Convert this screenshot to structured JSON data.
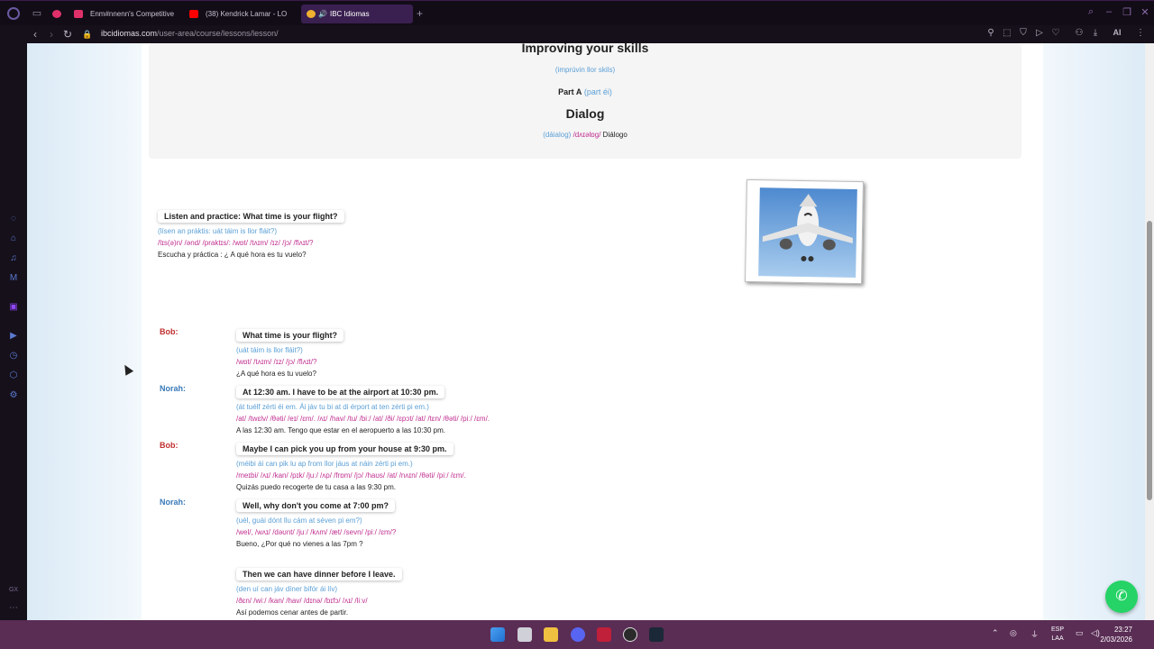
{
  "browser": {
    "tabs": [
      {
        "label": "Enm#nnenn's Competitive",
        "color": "#e0306a"
      },
      {
        "label": "(38) Kendrick Lamar - LO",
        "color": "#ff0000"
      },
      {
        "label": "IBC Idiomas",
        "color": "#f0b030"
      }
    ],
    "active_tab_icon": "speaker-icon",
    "url_host": "ibcidiomas.com",
    "url_path": "/user-area/course/lessons/lesson/",
    "right_icons": [
      "bookmark-icon",
      "snapshot-icon",
      "shield-icon",
      "play-icon",
      "heart-icon",
      "profile-icon",
      "download-icon"
    ],
    "ai_label": "AI"
  },
  "header": {
    "title": "Improving your skills",
    "title_pron": "(imprúvin llor skils)",
    "part_label": "Part A",
    "part_pron": "(part éi)",
    "dialog_title": "Dialog",
    "dialog_pron": "(dáialog)",
    "dialog_ipa": "/dʌɪəlɒg/",
    "dialog_es": "Diálogo"
  },
  "intro": {
    "title": "Listen and practice: What time is your flight?",
    "pron": "(lísen an práktis: uát táim is llor fláit?)",
    "ipa": "/lɪs(ə)n/ /ənd/ /praktɪs/: /wɒt/ /tʌɪm/ /ɪz/ /jɔ/ /flʌɪt/?",
    "es": "Escucha y práctica : ¿ A qué hora es tu vuelo?"
  },
  "dialog": [
    {
      "speaker": "Bob:",
      "speaker_color": "#c03030",
      "en": "What time is your flight?",
      "pron": "(uát táim is llor fláit?)",
      "ipa": "/wɒt/ /tʌɪm/ /ɪz/ /jɔ/ /flʌɪt/?",
      "es": "¿A qué hora es tu vuelo?"
    },
    {
      "speaker": "Norah:",
      "speaker_color": "#3a7ab8",
      "en": "At 12:30 am. I have to be at the airport at 10:30 pm.",
      "pron": "(át tuélf zérti éi em. Ái jáv tu bi at di érport at ten zérti pi em.)",
      "ipa": "/at/ /twɛlv/ /θəti/ /eɪ/ /ɛm/. /ʌɪ/ /hav/ /tu/ /biː/ /at/ /ði/ /ɛpɔt/ /at/ /tɛn/ /θəti/ /piː/ /ɛm/.",
      "es": "A las 12:30 am. Tengo que estar en el aeropuerto a las 10:30 pm."
    },
    {
      "speaker": "Bob:",
      "speaker_color": "#c03030",
      "en": "Maybe I can pick you up from your house at 9:30 pm.",
      "pron": "(méibi ái can pik lu ap from llor jáus at náin zérti pi em.)",
      "ipa": "/meɪbi/ /ʌɪ/ /kan/ /pɪk/ /juː/ /ʌp/ /frɒm/ /jɔ/ /haʊs/ /at/ /nʌɪn/ /θəti/ /piː/ /ɛm/.",
      "es": "Quizás puedo recogerte de tu casa a las 9:30 pm."
    },
    {
      "speaker": "Norah:",
      "speaker_color": "#3a7ab8",
      "en": "Well, why don't you come at 7:00 pm?",
      "pron": "(uél, guái dónt llu cám at séven pi em?)",
      "ipa": "/wel/, /wʌɪ/ /dəʊnt/ /juː/ /kʌm/ /æt/ /sevn/ /piː/ /ɛm/?",
      "es": "Bueno, ¿Por qué no vienes a las 7pm ?"
    },
    {
      "speaker": "",
      "speaker_color": "#3a7ab8",
      "en": "Then we can have dinner before I leave.",
      "pron": "(den uí can jáv díner bifór ái lív)",
      "ipa": "/ðɛn/ /wiː/ /kan/ /hav/ /dɪnə/ /bɪfɔ/ /ʌɪ/ /liːv/",
      "es": "Así podemos cenar antes de partir."
    }
  ],
  "taskbar": {
    "lang_top": "ESP",
    "lang_bottom": "LAA",
    "time": "23:27",
    "date": "2/03/2026"
  }
}
